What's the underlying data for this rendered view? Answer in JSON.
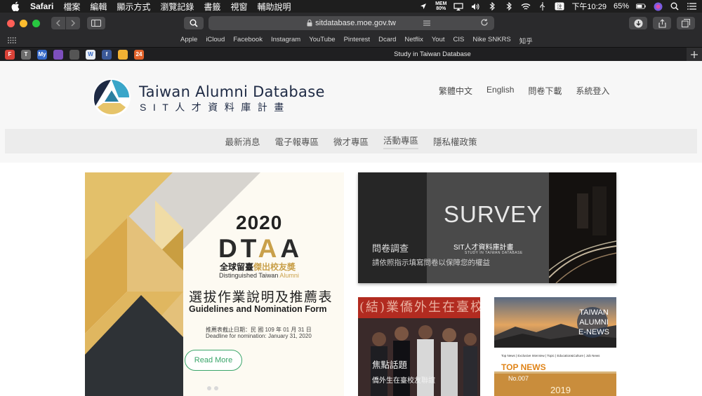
{
  "menubar": {
    "app": "Safari",
    "items": [
      "檔案",
      "編輯",
      "顯示方式",
      "瀏覽記錄",
      "書籤",
      "視窗",
      "輔助說明"
    ],
    "mem_label": "MEM",
    "mem_value": "80%",
    "time": "下午10:29",
    "battery": "65%"
  },
  "browser": {
    "url": "sitdatabase.moe.gov.tw",
    "favorites": [
      "Apple",
      "iCloud",
      "Facebook",
      "Instagram",
      "YouTube",
      "Pinterest",
      "Dcard",
      "Netflix",
      "Yout",
      "CIS",
      "Nike SNKRS",
      "知乎"
    ],
    "tab_title": "Study in Taiwan Database",
    "pinned_tabs": [
      {
        "label": "F",
        "color": "#d94238"
      },
      {
        "label": "T",
        "color": "#6d6d6d"
      },
      {
        "label": "My",
        "color": "#3568c8"
      },
      {
        "label": "",
        "color": "#7d4fbd"
      },
      {
        "label": "",
        "color": "#555555"
      },
      {
        "label": "W",
        "color": "#e9eef6"
      },
      {
        "label": "f",
        "color": "#3b5998"
      },
      {
        "label": "",
        "color": "#f2b233"
      },
      {
        "label": "24",
        "color": "#e2622a"
      }
    ]
  },
  "site": {
    "title": "Taiwan Alumni Database",
    "subtitle": "SIT人才資料庫計畫",
    "top_links": [
      "繁體中文",
      "English",
      "問卷下載",
      "系統登入"
    ],
    "nav": [
      "最新消息",
      "電子報專區",
      "微才專區",
      "活動專區",
      "隱私權政策"
    ],
    "colors": {
      "logo_teal": "#3aa6c9",
      "logo_gold": "#e6c46a",
      "logo_navy": "#1e2a44",
      "accent_green": "#3aa56a",
      "accent_orange": "#e08418"
    }
  },
  "slide": {
    "year": "2020",
    "acronym_lead": "DT",
    "acronym_a1": "A",
    "acronym_a2": "A",
    "cn_award_1": "全球留臺",
    "cn_award_2": "傑出校友獎",
    "en_award_1": "Distinguished Taiwan",
    "en_award_2": "Alumni",
    "cn_guide": "選拔作業說明及推薦表",
    "en_guide": "Guidelines and Nomination Form",
    "deadline_cn": "推薦表截止日期：民 國 109 年 01 月 31 日",
    "deadline_en": "Deadline for nomination: January 31, 2020",
    "read_more": "Read More"
  },
  "survey": {
    "word": "SURVEY",
    "sit": "SIT人才資料庫計畫",
    "sit_sub": "STUDY IN TAIWAN DATABASE",
    "title": "問卷調查",
    "desc": "請依照指示填寫問卷以保障您的權益"
  },
  "focus": {
    "banner": "(結)業僑外生在臺校友聯",
    "title": "焦點話題",
    "desc": "僑外生在臺校友聯誼"
  },
  "enews": {
    "label_lines": [
      "TAIWAN",
      "ALUMNI",
      "E-NEWS"
    ],
    "navline": "Top News | Exclusive Interview | Topic | Education&Culture | Job News",
    "top_news": "TOP NEWS",
    "issue": "No.007",
    "year": "2019"
  }
}
